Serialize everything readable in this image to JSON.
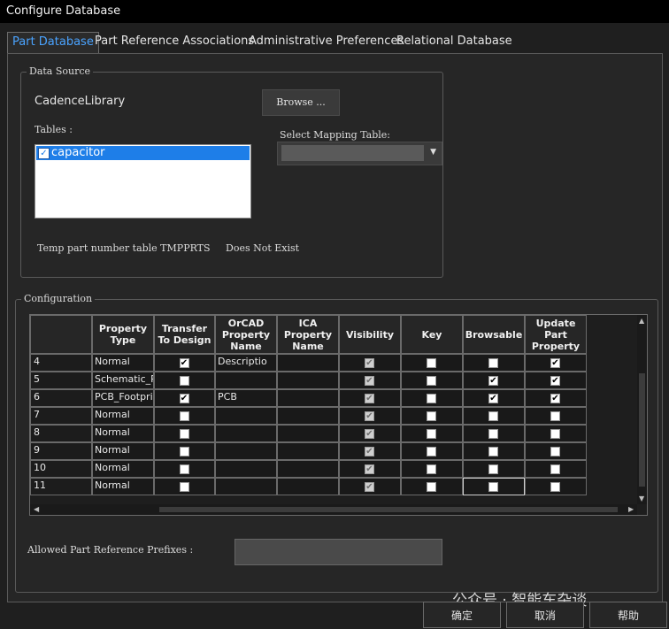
{
  "window": {
    "title": "Configure Database"
  },
  "tabs": [
    {
      "label": "Part Database",
      "active": true
    },
    {
      "label": "Part Reference Associations",
      "active": false
    },
    {
      "label": "Administrative Preferences",
      "active": false
    },
    {
      "label": "Relational Database",
      "active": false
    }
  ],
  "data_source": {
    "legend": "Data Source",
    "library_name": "CadenceLibrary",
    "browse_label": "Browse ...",
    "tables_label": "Tables :",
    "tables": [
      {
        "label": "capacitor",
        "checked": true,
        "selected": true
      }
    ],
    "mapping_label": "Select Mapping Table:",
    "mapping_value": "",
    "temp_text": "Temp part number table TMPPRTS",
    "exist_text": "Does Not Exist"
  },
  "configuration": {
    "legend": "Configuration",
    "columns": [
      "",
      "Property Type",
      "Transfer To Design",
      "OrCAD Property Name",
      "ICA Property Name",
      "Visibility",
      "Key",
      "Browsable",
      "Update Part Property"
    ],
    "rows": [
      {
        "num": "4",
        "type": "Normal",
        "transfer": true,
        "orcad": "Descriptio",
        "ica": "",
        "visibility": true,
        "key": false,
        "browsable": false,
        "update": true
      },
      {
        "num": "5",
        "type": "Schematic_Pa",
        "transfer": false,
        "orcad": "",
        "ica": "",
        "visibility": true,
        "key": false,
        "browsable": true,
        "update": true
      },
      {
        "num": "6",
        "type": "PCB_Footprint",
        "transfer": true,
        "orcad": "PCB",
        "ica": "",
        "visibility": true,
        "key": false,
        "browsable": true,
        "update": true
      },
      {
        "num": "7",
        "type": "Normal",
        "transfer": false,
        "orcad": "",
        "ica": "",
        "visibility": true,
        "key": false,
        "browsable": false,
        "update": false
      },
      {
        "num": "8",
        "type": "Normal",
        "transfer": false,
        "orcad": "",
        "ica": "",
        "visibility": true,
        "key": false,
        "browsable": false,
        "update": false
      },
      {
        "num": "9",
        "type": "Normal",
        "transfer": false,
        "orcad": "",
        "ica": "",
        "visibility": true,
        "key": false,
        "browsable": false,
        "update": false
      },
      {
        "num": "10",
        "type": "Normal",
        "transfer": false,
        "orcad": "",
        "ica": "",
        "visibility": true,
        "key": false,
        "browsable": false,
        "update": false
      },
      {
        "num": "11",
        "type": "Normal",
        "transfer": false,
        "orcad": "",
        "ica": "",
        "visibility": true,
        "key": false,
        "browsable": false,
        "update": false
      }
    ],
    "prefix_label": "Allowed Part Reference Prefixes :",
    "prefix_value": ""
  },
  "buttons": {
    "ok": "确定",
    "cancel": "取消",
    "help": "帮助"
  },
  "watermark": "公众号 · 智能车杂谈",
  "colors": {
    "accent": "#4aa3ff",
    "selection": "#1e7ee8"
  }
}
